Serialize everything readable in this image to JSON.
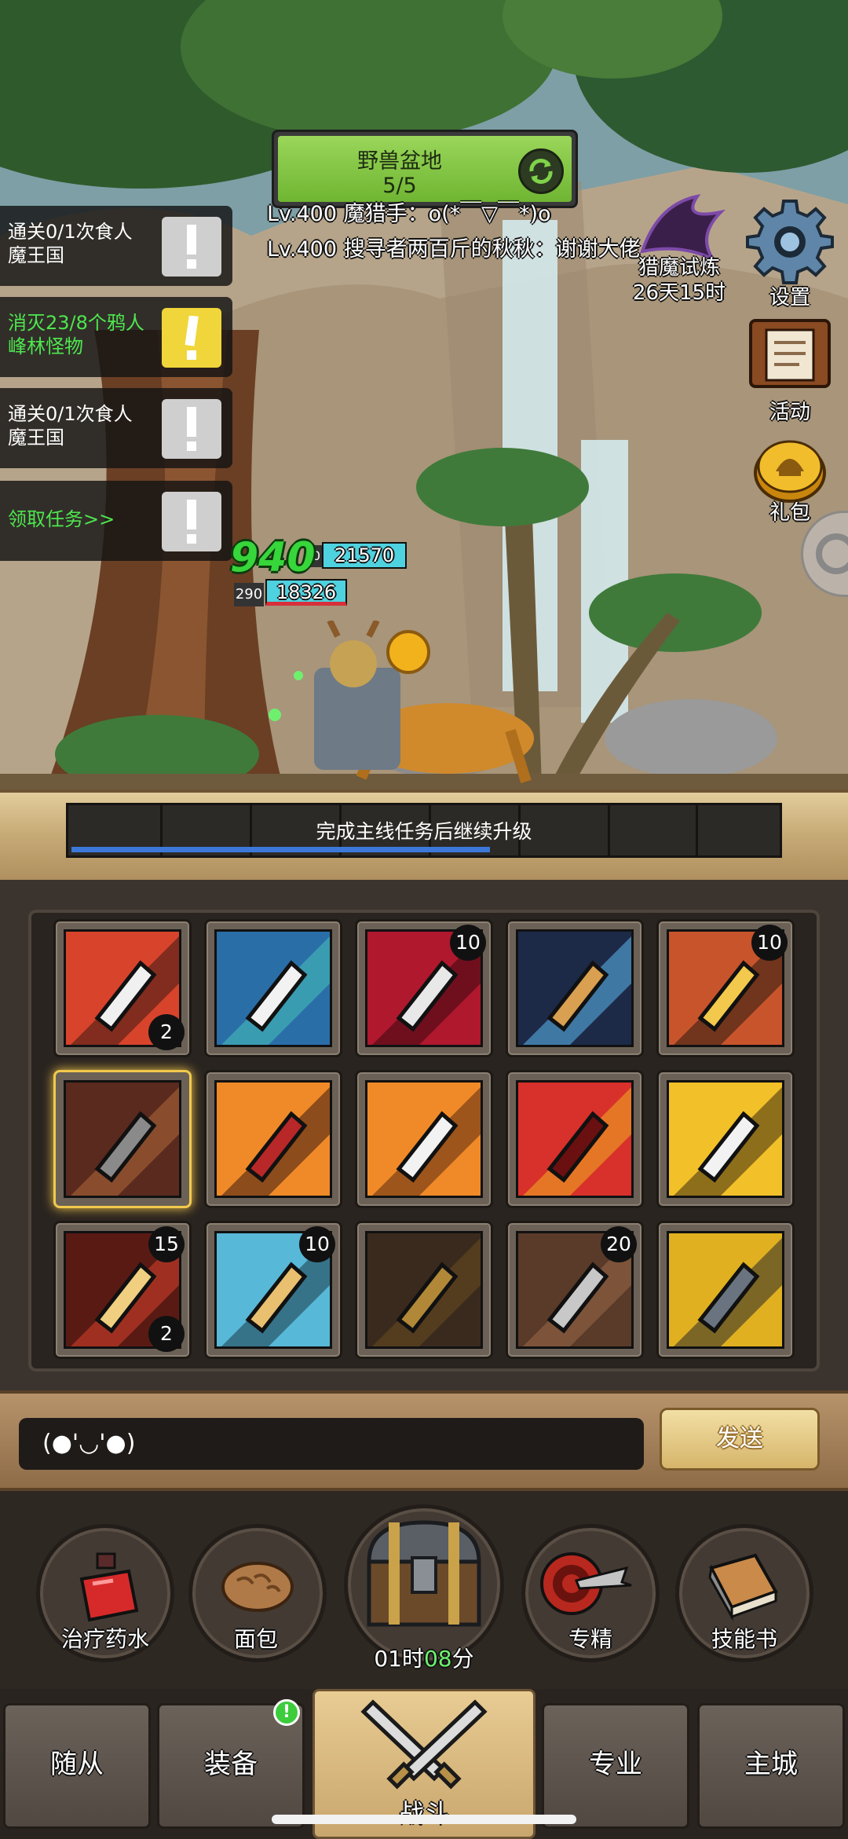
{
  "zone": {
    "name": "野兽盆地",
    "progress": "5/5"
  },
  "chat_lines": [
    "Lv.400 魔猎手：o(*￣▽￣*)o",
    "Lv.400 搜寻者两百斤的秋秋：谢谢大佬"
  ],
  "quests": [
    {
      "text": "通关0/1次食人魔王国",
      "active": false
    },
    {
      "text": "消灭23/8个鸦人峰林怪物",
      "active": true
    },
    {
      "text": "通关0/1次食人魔王国",
      "active": false
    },
    {
      "text": "领取任务>>",
      "active": true
    }
  ],
  "side_buttons": {
    "settings": "设置",
    "events": "活动",
    "gift": "礼包",
    "trial_name": "猎魔试炼",
    "trial_time": "26天15时"
  },
  "combat": {
    "damage": "940",
    "enemy_hp": "21570",
    "player_level": "290",
    "player_hp": "18326",
    "small_tag": "0"
  },
  "level_bar": {
    "text": "完成主线任务后继续升级",
    "fill_fraction": 0.59
  },
  "skills": [
    {
      "icon": "arrow-strike",
      "badge_top": "",
      "badge_bottom": "2"
    },
    {
      "icon": "hammer-slam",
      "badge_top": "",
      "badge_bottom": ""
    },
    {
      "icon": "crimson-blade",
      "badge_top": "10",
      "badge_bottom": ""
    },
    {
      "icon": "lightning-sword",
      "badge_top": "",
      "badge_bottom": ""
    },
    {
      "icon": "golden-slash",
      "badge_top": "10",
      "badge_bottom": ""
    },
    {
      "icon": "heavy-sword",
      "badge_top": "",
      "badge_bottom": ""
    },
    {
      "icon": "hooded-rage",
      "badge_top": "",
      "badge_bottom": ""
    },
    {
      "icon": "white-shield-burst",
      "badge_top": "",
      "badge_bottom": ""
    },
    {
      "icon": "red-war-banner",
      "badge_top": "",
      "badge_bottom": ""
    },
    {
      "icon": "yellow-fist",
      "badge_top": "",
      "badge_bottom": ""
    },
    {
      "icon": "split-strike",
      "badge_top": "15",
      "badge_bottom": "2"
    },
    {
      "icon": "sword-thrust",
      "badge_top": "10",
      "badge_bottom": ""
    },
    {
      "icon": "lion-shield",
      "badge_top": "",
      "badge_bottom": ""
    },
    {
      "icon": "gladiator",
      "badge_top": "20",
      "badge_bottom": ""
    },
    {
      "icon": "warlord",
      "badge_top": "",
      "badge_bottom": ""
    }
  ],
  "chat_input": {
    "value": "(●'◡'●)"
  },
  "send_label": "发送",
  "consumables": {
    "potion": "治疗药水",
    "bread": "面包",
    "chest_timer_h": "01时",
    "chest_timer_m": "08",
    "chest_timer_unit": "分",
    "mastery": "专精",
    "skillbook": "技能书"
  },
  "tabs": {
    "followers": "随从",
    "equipment": "装备",
    "battle": "战斗",
    "profession": "专业",
    "city": "主城",
    "equipment_notice": "!"
  },
  "colors": {
    "accent_green": "#4ee64e",
    "gold": "#f2c94c",
    "hp_cyan": "#4fd2e0",
    "xp_blue": "#3c78d8"
  }
}
